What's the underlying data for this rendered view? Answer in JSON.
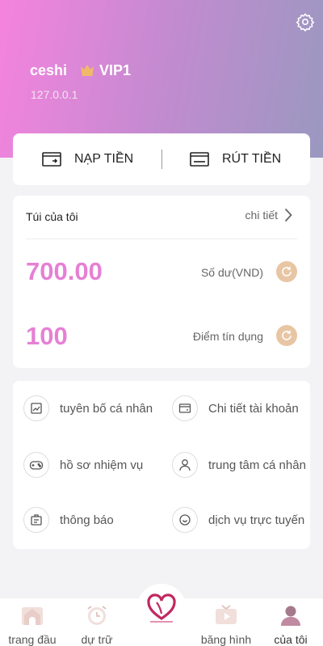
{
  "header": {
    "username": "ceshi",
    "vip_label": "VIP1",
    "ip": "127.0.0.1",
    "icons": {
      "settings": "gear-icon",
      "crown": "crown-icon"
    }
  },
  "actions": {
    "deposit_label": "NẠP TIỀN",
    "withdraw_label": "RÚT TIỀN"
  },
  "wallet": {
    "title": "Túi của tôi",
    "detail_label": "chi tiết",
    "balance_value": "700.00",
    "balance_label": "Số dư(VND)",
    "credit_value": "100",
    "credit_label": "Điểm tín dụng"
  },
  "menu": {
    "items": [
      {
        "label": "tuyên bố cá nhân",
        "icon": "chart-icon"
      },
      {
        "label": "Chi tiết tài khoản",
        "icon": "wallet-icon"
      },
      {
        "label": "hồ sơ nhiệm vụ",
        "icon": "gamepad-icon"
      },
      {
        "label": "trung tâm cá nhân",
        "icon": "user-icon"
      },
      {
        "label": "thông báo",
        "icon": "notice-icon"
      },
      {
        "label": "dịch vụ trực tuyến",
        "icon": "chat-icon"
      }
    ]
  },
  "tabbar": {
    "items": [
      {
        "label": "trang đầu",
        "icon": "home-icon"
      },
      {
        "label": "dự trữ",
        "icon": "clock-icon"
      },
      {
        "label": "",
        "icon": "heart-logo-icon"
      },
      {
        "label": "băng hình",
        "icon": "tv-icon"
      },
      {
        "label": "của tôi",
        "icon": "person-icon"
      }
    ]
  },
  "colors": {
    "accent": "#e680d4",
    "refresh_bg": "#e8c6a4",
    "header_gradient": [
      "#f583de",
      "#9a98c0"
    ]
  }
}
